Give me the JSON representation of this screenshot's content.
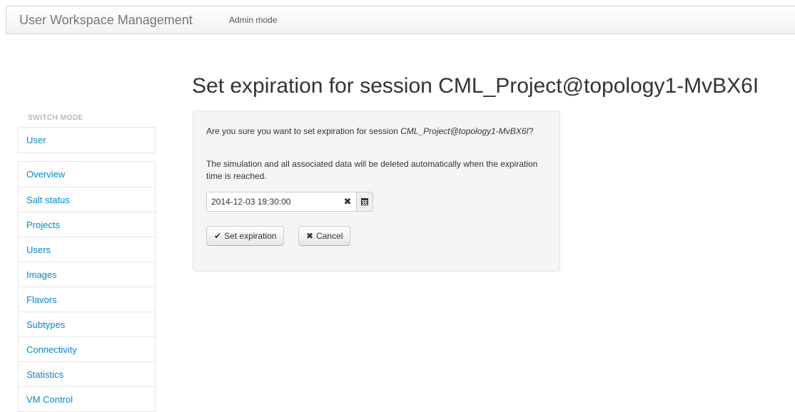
{
  "navbar": {
    "brand": "User Workspace Management",
    "mode_label": "Admin mode"
  },
  "page": {
    "title": "Set expiration for session CML_Project@topology1-MvBX6I"
  },
  "sidebar": {
    "switch_mode_label": "SWITCH MODE",
    "mode_items": [
      {
        "label": "User"
      }
    ],
    "items": [
      {
        "label": "Overview"
      },
      {
        "label": "Salt status"
      },
      {
        "label": "Projects"
      },
      {
        "label": "Users"
      },
      {
        "label": "Images"
      },
      {
        "label": "Flavors"
      },
      {
        "label": "Subtypes"
      },
      {
        "label": "Connectivity"
      },
      {
        "label": "Statistics"
      },
      {
        "label": "VM Control"
      }
    ]
  },
  "dialog": {
    "confirm_prefix": "Are you sure you want to set expiration for session ",
    "session_name": "CML_Project@topology1-MvBX6I",
    "confirm_suffix": "?",
    "info": "The simulation and all associated data will be deleted automatically when the expiration time is reached.",
    "expiration_value": "2014-12-03 19:30:00",
    "clear_icon": "times-icon",
    "calendar_icon": "calendar-icon",
    "set_button": {
      "label": "Set expiration",
      "icon": "check-icon"
    },
    "cancel_button": {
      "label": "Cancel",
      "icon": "times-icon"
    }
  },
  "colors": {
    "link": "#0088cc",
    "panel_bg": "#f5f5f5",
    "navbar_bg": "#f7f7f7"
  }
}
